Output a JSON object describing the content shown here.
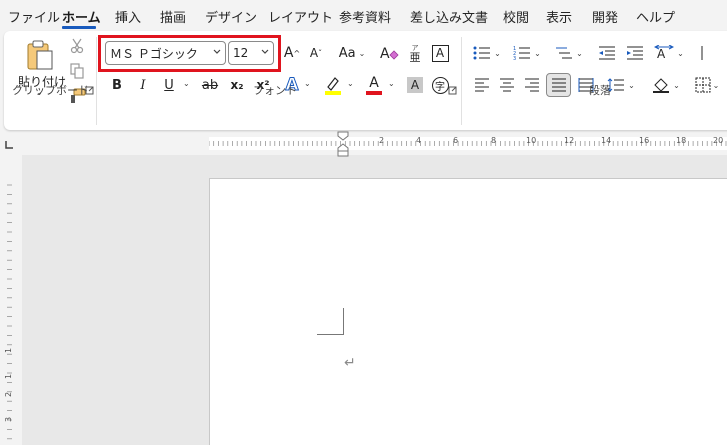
{
  "tabs": [
    "ファイル",
    "ホーム",
    "挿入",
    "描画",
    "デザイン",
    "レイアウト",
    "参考資料",
    "差し込み文書",
    "校閲",
    "表示",
    "開発",
    "ヘルプ"
  ],
  "active_tab": "ホーム",
  "clipboard": {
    "group_label": "クリップボード",
    "paste_label": "貼り付け"
  },
  "font": {
    "group_label": "フォント",
    "font_name": "ＭＳ Ｐゴシック",
    "font_size": "12",
    "grow_label": "A",
    "shrink_label": "A",
    "case_label": "Aa",
    "bold_label": "B",
    "italic_label": "I",
    "underline_label": "U",
    "strike_label": "ab",
    "subscript_label": "x₂",
    "superscript_label": "x²",
    "effects_label": "A",
    "font_color_label": "A",
    "shading_label": "A",
    "enclose_label": "字",
    "ruby_label": "亜",
    "border_char_label": "A",
    "highlight_color": "#ffff00",
    "font_color": "#e0141e"
  },
  "paragraph": {
    "group_label": "段落"
  },
  "ruler": {
    "labels": [
      "2",
      "2",
      "4",
      "6",
      "8",
      "10",
      "12",
      "14",
      "16",
      "18",
      "20"
    ],
    "v_labels": [
      "1",
      "1",
      "2",
      "3"
    ]
  },
  "document": {
    "paragraph_mark": "↵"
  },
  "colors": {
    "accent": "#185abd",
    "highlight_box": "#e0141e"
  }
}
